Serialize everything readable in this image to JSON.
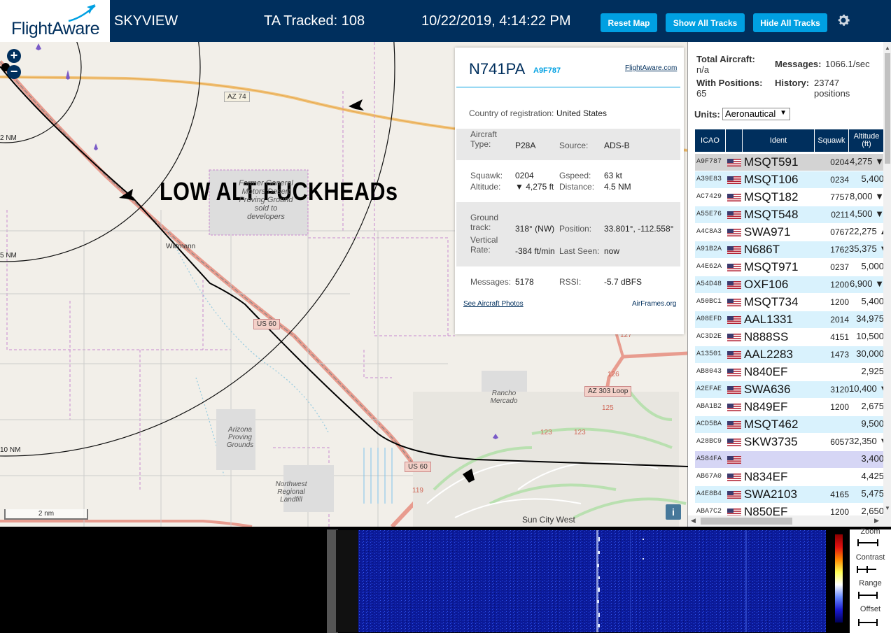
{
  "header": {
    "logo_text": "FlightAware",
    "site_name": "SKYVIEW",
    "ta_tracked": "TA Tracked: 108",
    "datetime": "10/22/2019, 4:14:22 PM",
    "buttons": {
      "reset_map": "Reset Map",
      "show_all_tracks": "Show All Tracks",
      "hide_all_tracks": "Hide All Tracks"
    },
    "settings_icon": "gear-icon"
  },
  "map": {
    "zoom_in": "+",
    "zoom_out": "−",
    "annotation": "LOW ALT FUCKHEADs",
    "ring_labels": [
      "2 NM",
      "5 NM",
      "10 NM"
    ],
    "road_labels": [
      "AZ 74",
      "US 60",
      "US 60",
      "AZ 303 Loop",
      "123",
      "123",
      "125",
      "126",
      "127",
      "119"
    ],
    "place_labels": {
      "former_proving": "Former General Motors Desert Proving Ground sold to developers",
      "wittmann": "Wittmann",
      "arizona_proving": "Arizona Proving Grounds",
      "northwest_landfill": "Northwest Regional Landfill",
      "rancho_mercado": "Rancho Mercado",
      "sun_city_west": "Sun City West"
    },
    "scale_label": "2 nm",
    "info_button": "i"
  },
  "popup": {
    "ident": "N741PA",
    "hex": "A9F787",
    "fa_link": "FlightAware.com",
    "country_label": "Country of registration:",
    "country_value": "United States",
    "aircraft_type_label": "Aircraft Type:",
    "aircraft_type_value": "P28A",
    "source_label": "Source:",
    "source_value": "ADS-B",
    "squawk_label": "Squawk:",
    "squawk_value": "0204",
    "altitude_label": "Altitude:",
    "altitude_value": "▼ 4,275 ft",
    "gspeed_label": "Gspeed:",
    "gspeed_value": "63 kt",
    "distance_label": "Distance:",
    "distance_value": "4.5 NM",
    "ground_track_label": "Ground track:",
    "ground_track_value": "318° (NW)",
    "position_label": "Position:",
    "position_value": "33.801°, -112.558°",
    "vertical_rate_label": "Vertical Rate:",
    "vertical_rate_value": "-384 ft/min",
    "last_seen_label": "Last Seen:",
    "last_seen_value": "now",
    "messages_label": "Messages:",
    "messages_value": "5178",
    "rssi_label": "RSSI:",
    "rssi_value": "-5.7 dBFS",
    "photos_link": "See Aircraft Photos",
    "airframes_link": "AirFrames.org"
  },
  "stats": {
    "total_aircraft_label": "Total Aircraft:",
    "total_aircraft_value": "n/a",
    "messages_label": "Messages:",
    "messages_value": "1066.1/sec",
    "with_positions_label": "With Positions:",
    "with_positions_value": "65",
    "history_label": "History:",
    "history_value": "23747 positions",
    "units_label": "Units:",
    "units_value": "Aeronautical"
  },
  "table": {
    "columns": [
      "ICAO",
      "",
      "Ident",
      "Squawk",
      "Altitude (ft)"
    ],
    "rows": [
      {
        "icao": "A9F787",
        "ident": "MSQT591",
        "squawk": "0204",
        "altitude": "4,275 ▼"
      },
      {
        "icao": "A39E83",
        "ident": "MSQT106",
        "squawk": "0234",
        "altitude": "5,400"
      },
      {
        "icao": "AC7429",
        "ident": "MSQT182",
        "squawk": "7757",
        "altitude": "8,000 ▼"
      },
      {
        "icao": "A55E76",
        "ident": "MSQT548",
        "squawk": "0211",
        "altitude": "4,500 ▼"
      },
      {
        "icao": "A4C8A3",
        "ident": "SWA971",
        "squawk": "0767",
        "altitude": "22,275 ▲"
      },
      {
        "icao": "A91B2A",
        "ident": "N686T",
        "squawk": "1762",
        "altitude": "35,375 ▼"
      },
      {
        "icao": "A4E62A",
        "ident": "MSQT971",
        "squawk": "0237",
        "altitude": "5,000"
      },
      {
        "icao": "A54D48",
        "ident": "OXF106",
        "squawk": "1200",
        "altitude": "6,900 ▼"
      },
      {
        "icao": "A50BC1",
        "ident": "MSQT734",
        "squawk": "1200",
        "altitude": "5,400"
      },
      {
        "icao": "A08EFD",
        "ident": "AAL1331",
        "squawk": "2014",
        "altitude": "34,975"
      },
      {
        "icao": "AC3D2E",
        "ident": "N888SS",
        "squawk": "4151",
        "altitude": "10,500"
      },
      {
        "icao": "A13501",
        "ident": "AAL2283",
        "squawk": "1473",
        "altitude": "30,000"
      },
      {
        "icao": "AB8043",
        "ident": "N840EF",
        "squawk": "",
        "altitude": "2,925"
      },
      {
        "icao": "A2EFAE",
        "ident": "SWA636",
        "squawk": "3120",
        "altitude": "10,400 ▼"
      },
      {
        "icao": "ABA1B2",
        "ident": "N849EF",
        "squawk": "1200",
        "altitude": "2,675"
      },
      {
        "icao": "ACD5BA",
        "ident": "MSQT462",
        "squawk": "",
        "altitude": "9,500"
      },
      {
        "icao": "A28BC9",
        "ident": "SKW3735",
        "squawk": "6057",
        "altitude": "32,350 ▼"
      },
      {
        "icao": "A584FA",
        "ident": "",
        "squawk": "",
        "altitude": "3,400"
      },
      {
        "icao": "AB67A0",
        "ident": "N834EF",
        "squawk": "",
        "altitude": "4,425"
      },
      {
        "icao": "A4E8B4",
        "ident": "SWA2103",
        "squawk": "4165",
        "altitude": "5,475"
      },
      {
        "icao": "ABA7C2",
        "ident": "N850EF",
        "squawk": "1200",
        "altitude": "2,650"
      }
    ]
  },
  "spectrum_controls": {
    "zoom": "Zoom",
    "contrast": "Contrast",
    "range": "Range",
    "offset": "Offset"
  },
  "colors": {
    "header_bg": "#002f5d",
    "accent": "#00a0e2",
    "row_alt": "#d9f2fd"
  }
}
